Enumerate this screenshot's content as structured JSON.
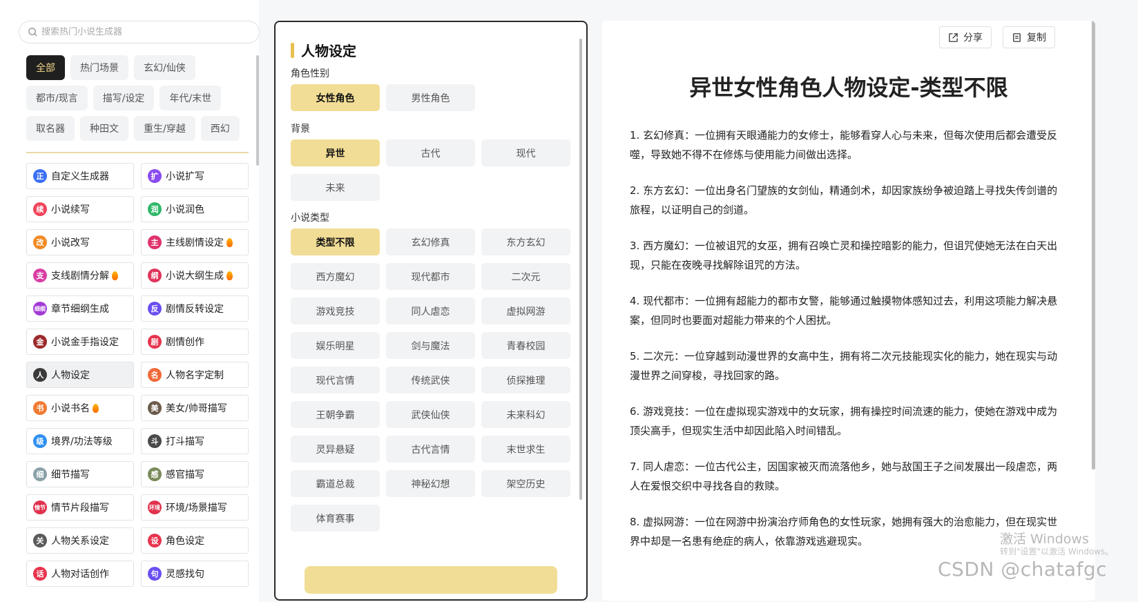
{
  "search": {
    "placeholder": "搜索热门小说生成器"
  },
  "categories": [
    "全部",
    "热门场景",
    "玄幻/仙侠",
    "都市/现言",
    "描写/设定",
    "年代/末世",
    "取名器",
    "种田文",
    "重生/穿越",
    "西幻"
  ],
  "tools": [
    {
      "label": "自定义生成器",
      "icon": "正",
      "color": "#3b6ff5",
      "hot": false
    },
    {
      "label": "小说扩写",
      "icon": "扩",
      "color": "#8a4bf0",
      "hot": false
    },
    {
      "label": "小说续写",
      "icon": "续",
      "color": "#f0445b",
      "hot": false
    },
    {
      "label": "小说润色",
      "icon": "润",
      "color": "#2fb86a",
      "hot": false
    },
    {
      "label": "小说改写",
      "icon": "改",
      "color": "#f08a24",
      "hot": false
    },
    {
      "label": "主线剧情设定",
      "icon": "主",
      "color": "#e0336b",
      "hot": true
    },
    {
      "label": "支线剧情分解",
      "icon": "支",
      "color": "#d93ea3",
      "hot": true
    },
    {
      "label": "小说大纲生成",
      "icon": "纲",
      "color": "#e0335a",
      "hot": true
    },
    {
      "label": "章节细纲生成",
      "icon": "细纲",
      "color": "#a33ad6",
      "hot": false
    },
    {
      "label": "剧情反转设定",
      "icon": "反",
      "color": "#6b4ff0",
      "hot": false
    },
    {
      "label": "小说金手指设定",
      "icon": "金",
      "color": "#9b2a2a",
      "hot": false
    },
    {
      "label": "剧情创作",
      "icon": "剧",
      "color": "#e8344e",
      "hot": false
    },
    {
      "label": "人物设定",
      "icon": "人",
      "color": "#3a3a3a",
      "hot": false
    },
    {
      "label": "人物名字定制",
      "icon": "名",
      "color": "#f06a3a",
      "hot": false
    },
    {
      "label": "小说书名",
      "icon": "书",
      "color": "#f07a30",
      "hot": true
    },
    {
      "label": "美女/帅哥描写",
      "icon": "美",
      "color": "#6b5b4b",
      "hot": false
    },
    {
      "label": "境界/功法等级",
      "icon": "级",
      "color": "#2f8ff0",
      "hot": false
    },
    {
      "label": "打斗描写",
      "icon": "斗",
      "color": "#4a4a4a",
      "hot": false
    },
    {
      "label": "细节描写",
      "icon": "细",
      "color": "#8aa0a8",
      "hot": false
    },
    {
      "label": "感官描写",
      "icon": "感",
      "color": "#7a8a5a",
      "hot": false
    },
    {
      "label": "情节片段描写",
      "icon": "情节",
      "color": "#e0334e",
      "hot": false
    },
    {
      "label": "环境/场景描写",
      "icon": "环境",
      "color": "#e0334e",
      "hot": false
    },
    {
      "label": "人物关系设定",
      "icon": "关",
      "color": "#5a5a5a",
      "hot": false
    },
    {
      "label": "角色设定",
      "icon": "设",
      "color": "#e8344e",
      "hot": false
    },
    {
      "label": "人物对话创作",
      "icon": "话",
      "color": "#e8344e",
      "hot": false
    },
    {
      "label": "灵感找句",
      "icon": "句",
      "color": "#6b4ff0",
      "hot": false
    }
  ],
  "middle": {
    "title": "人物设定",
    "groups": [
      {
        "label": "角色性别",
        "options": [
          "女性角色",
          "男性角色"
        ],
        "selected": "女性角色"
      },
      {
        "label": "背景",
        "options": [
          "异世",
          "古代",
          "现代",
          "未来"
        ],
        "selected": "异世"
      },
      {
        "label": "小说类型",
        "options": [
          "类型不限",
          "玄幻修真",
          "东方玄幻",
          "西方魔幻",
          "现代都市",
          "二次元",
          "游戏竞技",
          "同人虐恋",
          "虚拟网游",
          "娱乐明星",
          "剑与魔法",
          "青春校园",
          "现代言情",
          "传统武侠",
          "侦探推理",
          "王朝争霸",
          "武侠仙侠",
          "未来科幻",
          "灵异悬疑",
          "古代言情",
          "末世求生",
          "霸道总裁",
          "神秘幻想",
          "架空历史",
          "体育赛事"
        ],
        "selected": "类型不限"
      }
    ]
  },
  "right": {
    "share_label": "分享",
    "copy_label": "复制",
    "title": "异世女性角色人物设定-类型不限",
    "paragraphs": [
      "1. 玄幻修真：一位拥有天眼通能力的女修士，能够看穿人心与未来，但每次使用后都会遭受反噬，导致她不得不在修炼与使用能力间做出选择。",
      "2. 东方玄幻：一位出身名门望族的女剑仙，精通剑术，却因家族纷争被迫踏上寻找失传剑谱的旅程，以证明自己的剑道。",
      "3. 西方魔幻：一位被诅咒的女巫，拥有召唤亡灵和操控暗影的能力，但诅咒使她无法在白天出现，只能在夜晚寻找解除诅咒的方法。",
      "4. 现代都市：一位拥有超能力的都市女警，能够通过触摸物体感知过去，利用这项能力解决悬案，但同时也要面对超能力带来的个人困扰。",
      "5. 二次元：一位穿越到动漫世界的女高中生，拥有将二次元技能现实化的能力，她在现实与动漫世界之间穿梭，寻找回家的路。",
      "6. 游戏竞技：一位在虚拟现实游戏中的女玩家，拥有操控时间流速的能力，使她在游戏中成为顶尖高手，但现实生活中却因此陷入时间错乱。",
      "7. 同人虐恋：一位古代公主，因国家被灭而流落他乡，她与敌国王子之间发展出一段虐恋，两人在爱恨交织中寻找各自的救赎。",
      "8. 虚拟网游：一位在网游中扮演治疗师角色的女性玩家，她拥有强大的治愈能力，但在现实世界中却是一名患有绝症的病人，依靠游戏逃避现实。"
    ]
  },
  "watermark": {
    "line1": "激活 Windows",
    "line2": "转到\"设置\"以激活 Windows。",
    "csdn": "CSDN @chatafgc"
  }
}
